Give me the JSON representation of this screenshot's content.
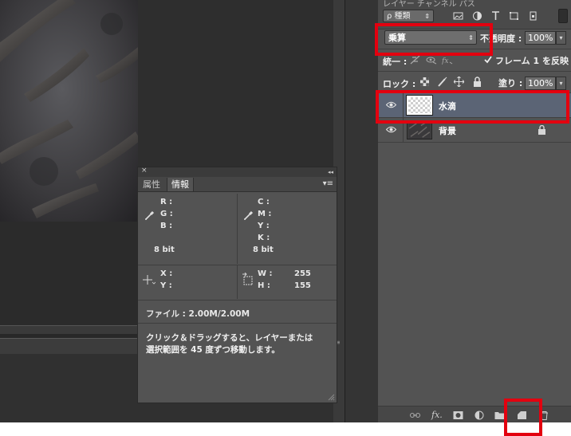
{
  "info_panel": {
    "close_glyph": "×",
    "collapse_glyph": "◂◂",
    "tabs": [
      {
        "label": "属性",
        "active": false
      },
      {
        "label": "情報",
        "active": true
      }
    ],
    "menu_glyph": "▾≡",
    "rgb": {
      "r": "R :",
      "g": "G :",
      "b": "B :",
      "depth": "8 bit"
    },
    "cmyk": {
      "c": "C :",
      "m": "M :",
      "y": "Y :",
      "k": "K :",
      "depth": "8 bit"
    },
    "position": {
      "x": "X :",
      "y": "Y :"
    },
    "size": {
      "w_label": "W :",
      "w_value": "255",
      "h_label": "H :",
      "h_value": "155"
    },
    "file_size": "ファイル : 2.00M/2.00M",
    "hint_line1": "クリック＆ドラッグすると、レイヤーまたは",
    "hint_line2": "選択範囲を 45 度ずつ移動します。"
  },
  "layers_panel": {
    "tabs_partial": "レイヤー   チャンネル   パス",
    "kind_filter": "ρ 種類",
    "kind_arrows": "⇕",
    "blend_mode": "乗算",
    "blend_arrows": "⇕",
    "opacity_label": "不透明度 :",
    "opacity_value": "100%",
    "unify_label": "統一 :",
    "propagate_label": "フレーム 1 を反映",
    "propagate_checked": true,
    "lock_label": "ロック :",
    "fill_label": "塗り :",
    "fill_value": "100%",
    "layers": [
      {
        "name": "水滴",
        "visible": true,
        "selected": true,
        "locked": false,
        "thumbnail": "transparent-checker"
      },
      {
        "name": "背景",
        "visible": true,
        "selected": false,
        "locked": true,
        "thumbnail": "metal-plate"
      }
    ],
    "bottom_icons": [
      "link-icon",
      "fx-icon",
      "mask-icon",
      "adjustment-icon",
      "folder-icon",
      "new-layer-icon",
      "trash-icon"
    ]
  },
  "colors": {
    "highlight": "#e3000f",
    "panel_bg": "#535353",
    "selected_layer": "#5b6475"
  }
}
